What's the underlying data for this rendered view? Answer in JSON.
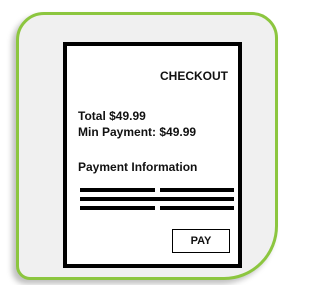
{
  "checkout": {
    "title": "CHECKOUT",
    "total": "Total $49.99",
    "min_payment": "Min Payment: $49.99",
    "payment_info": "Payment Information",
    "pay_label": "PAY"
  },
  "colors": {
    "tile_border": "#8cc63f",
    "tile_background": "#f0f0f0",
    "receipt_border": "#000000"
  }
}
